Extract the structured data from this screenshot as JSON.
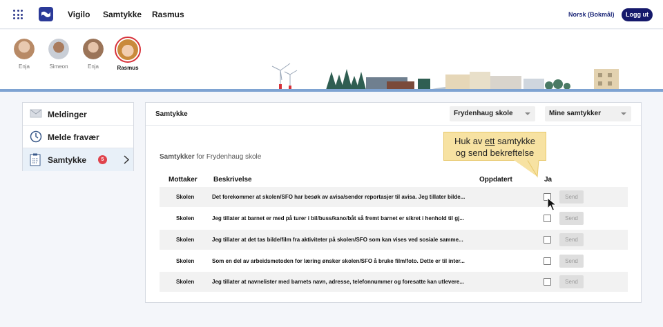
{
  "topbar": {
    "nav": [
      "Vigilo",
      "Samtykke",
      "Rasmus"
    ],
    "language": "Norsk (Bokmål)",
    "logout_label": "Logg ut"
  },
  "children": [
    {
      "name": "Enja",
      "selected": false
    },
    {
      "name": "Simeon",
      "selected": false
    },
    {
      "name": "Enja",
      "selected": false
    },
    {
      "name": "Rasmus",
      "selected": true
    }
  ],
  "sidebar": {
    "items": [
      {
        "label": "Meldinger",
        "icon": "envelope-icon"
      },
      {
        "label": "Melde fravær",
        "icon": "clock-icon"
      },
      {
        "label": "Samtykke",
        "icon": "clipboard-icon",
        "badge": "5",
        "active": true
      }
    ]
  },
  "panel": {
    "title": "Samtykke",
    "school_select": "Frydenhaug skole",
    "filter_select": "Mine samtykker",
    "subtitle_bold": "Samtykker",
    "subtitle_rest": " for Frydenhaug skole",
    "columns": {
      "recipient": "Mottaker",
      "description": "Beskrivelse",
      "updated": "Oppdatert",
      "yes": "Ja"
    },
    "rows": [
      {
        "recipient": "Skolen",
        "description": "Det forekommer at skolen/SFO har besøk av avisa/sender reportasjer til avisa. Jeg tillater bilde..."
      },
      {
        "recipient": "Skolen",
        "description": "Jeg tillater at barnet er med på turer i bil/buss/kano/båt så fremt barnet er sikret i henhold til gj..."
      },
      {
        "recipient": "Skolen",
        "description": "Jeg tillater at det tas bilde/film fra aktiviteter på skolen/SFO som kan vises ved sosiale samme..."
      },
      {
        "recipient": "Skolen",
        "description": "Som en del av arbeidsmetoden for læring ønsker skolen/SFO å bruke film/foto. Dette er til inter..."
      },
      {
        "recipient": "Skolen",
        "description": "Jeg tillater at navnelister med barnets navn, adresse, telefonnummer og foresatte kan utlevere..."
      }
    ],
    "send_label": "Send"
  },
  "tooltip": {
    "part1": "Huk av ",
    "underlined": "ett",
    "part2": " samtykke",
    "line2": "og send bekreftelse"
  },
  "colors": {
    "brand": "#2b3a98",
    "logout": "#15196b",
    "badge": "#e0434c",
    "tooltip": "#f7e2a2"
  }
}
